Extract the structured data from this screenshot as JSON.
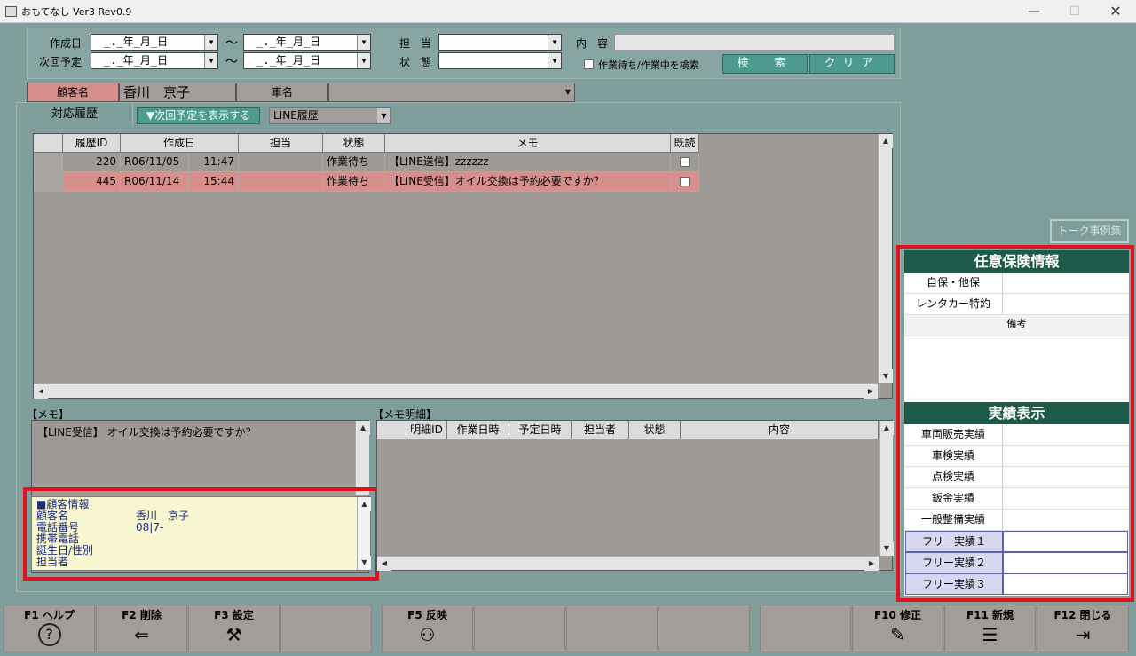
{
  "window": {
    "title": "おもてなし Ver3 Rev0.9"
  },
  "search": {
    "created_label": "作成日",
    "next_label": "次回予定",
    "date_placeholder": "_._年_月_日",
    "tilde": "〜",
    "staff_label": "担　当",
    "status_label": "状　態",
    "content_label": "内　容",
    "waiting_check_label": "作業待ち/作業中を検索",
    "search_button": "検　索",
    "clear_button": "クリア"
  },
  "customer": {
    "name_label": "顧客名",
    "name_value": "香川　京子",
    "car_label": "車名"
  },
  "tabs": {
    "history_tab": "対応履歴",
    "show_next_button": "▼次回予定を表示する",
    "line_select": "LINE履歴"
  },
  "history": {
    "headers": [
      "履歴ID",
      "作成日",
      "",
      "担当",
      "状態",
      "メモ",
      "既読"
    ],
    "rows": [
      {
        "id": "220",
        "date": "R06/11/05",
        "time": "11:47",
        "staff": "",
        "status": "作業待ち",
        "memo": "【LINE送信】zzzzzz"
      },
      {
        "id": "445",
        "date": "R06/11/14",
        "time": "15:44",
        "staff": "",
        "status": "作業待ち",
        "memo": "【LINE受信】オイル交換は予約必要ですか？"
      }
    ]
  },
  "memo": {
    "label": "【メモ】",
    "text": "【LINE受信】 オイル交換は予約必要ですか？"
  },
  "custinfo": {
    "heading": "■顧客情報",
    "lines": [
      {
        "k": "顧客名",
        "v": "香川　京子"
      },
      {
        "k": "電話番号",
        "v": "08|7-"
      },
      {
        "k": "携帯電話",
        "v": ""
      },
      {
        "k": "誕生日/性別",
        "v": ""
      },
      {
        "k": "担当者",
        "v": ""
      }
    ]
  },
  "memo_detail": {
    "label": "【メモ明細】",
    "headers": [
      "明細ID",
      "作業日時",
      "予定日時",
      "担当者",
      "状態",
      "内容"
    ]
  },
  "talk_button": "トーク事例集",
  "insurance": {
    "heading": "任意保険情報",
    "rows": [
      "自保・他保",
      "レンタカー特約"
    ],
    "note_label": "備考"
  },
  "results": {
    "heading": "実績表示",
    "rows": [
      "車両販売実績",
      "車検実績",
      "点検実績",
      "鈑金実績",
      "一般整備実績"
    ],
    "free_rows": [
      "フリー実績１",
      "フリー実績２",
      "フリー実績３"
    ]
  },
  "fkeys": [
    {
      "label": "F1 ヘルプ",
      "icon": "?"
    },
    {
      "label": "F2 削除",
      "icon": "⇐"
    },
    {
      "label": "F3 設定",
      "icon": "⚒"
    },
    {
      "label": "",
      "icon": ""
    },
    {
      "label": "F5 反映",
      "icon": "⚇"
    },
    {
      "label": "",
      "icon": ""
    },
    {
      "label": "",
      "icon": ""
    },
    {
      "label": "",
      "icon": ""
    },
    {
      "label": "",
      "icon": ""
    },
    {
      "label": "F10 修正",
      "icon": "✎"
    },
    {
      "label": "F11 新規",
      "icon": "☰"
    },
    {
      "label": "F12 閉じる",
      "icon": "⇥"
    }
  ],
  "colors": {
    "accent_red": "#e0121c",
    "section_green": "#1d5a4a",
    "teal_button": "#4d9a8e",
    "row_highlight": "#d78f8c"
  }
}
